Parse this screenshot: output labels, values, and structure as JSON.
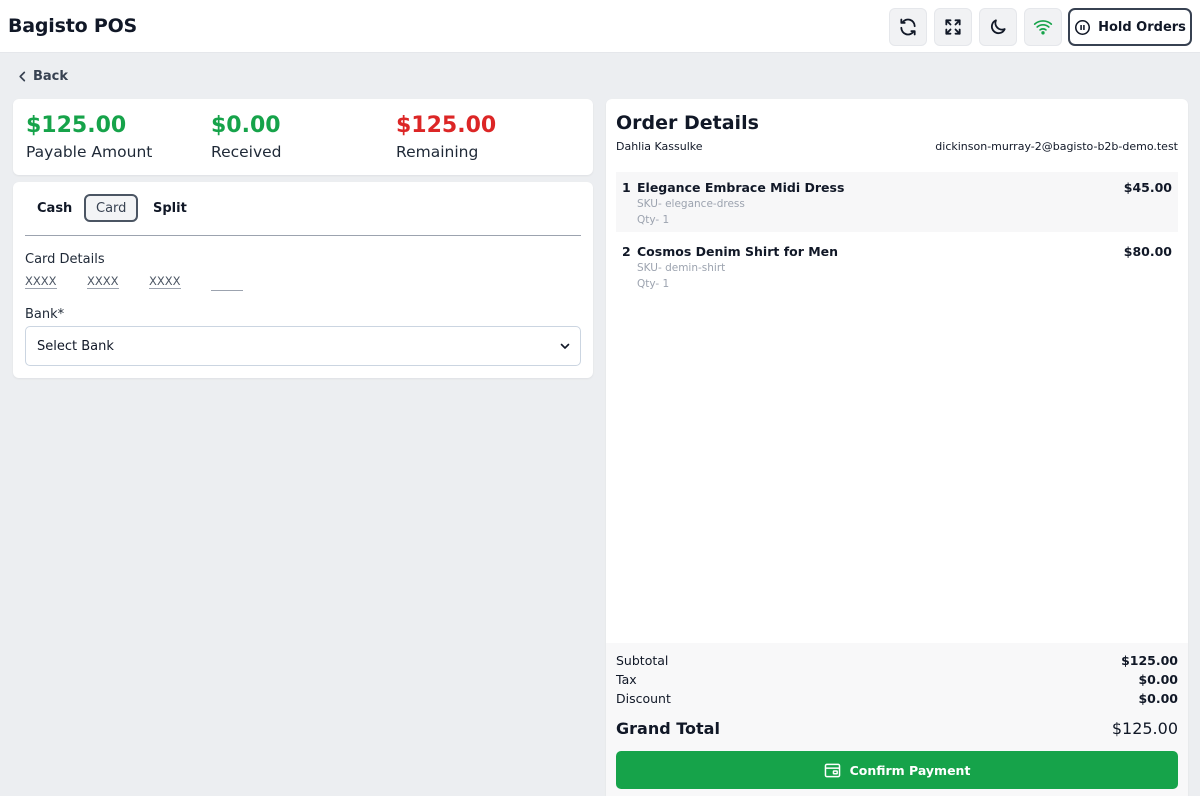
{
  "header": {
    "title": "Bagisto POS",
    "hold_label": "Hold Orders"
  },
  "nav": {
    "back_label": "Back"
  },
  "summary": {
    "payable": {
      "value": "$125.00",
      "label": "Payable Amount"
    },
    "received": {
      "value": "$0.00",
      "label": "Received"
    },
    "remaining": {
      "value": "$125.00",
      "label": "Remaining"
    }
  },
  "payment": {
    "tabs": [
      {
        "label": "Cash",
        "active": false
      },
      {
        "label": "Card",
        "active": true
      },
      {
        "label": "Split",
        "active": false
      }
    ],
    "card_details_label": "Card Details",
    "card_placeholders": [
      "XXXX",
      "XXXX",
      "XXXX",
      ""
    ],
    "bank_label": "Bank*",
    "bank_select_value": "Select Bank"
  },
  "order": {
    "title": "Order Details",
    "customer_name": "Dahlia Kassulke",
    "customer_email": "dickinson-murray-2@bagisto-b2b-demo.test",
    "items": [
      {
        "index": "1",
        "name": "Elegance Embrace Midi Dress",
        "sku": "SKU- elegance-dress",
        "qty": "Qty- 1",
        "price": "$45.00"
      },
      {
        "index": "2",
        "name": "Cosmos Denim Shirt for Men",
        "sku": "SKU- demin-shirt",
        "qty": "Qty- 1",
        "price": "$80.00"
      }
    ],
    "totals": {
      "subtotal": {
        "label": "Subtotal",
        "value": "$125.00"
      },
      "tax": {
        "label": "Tax",
        "value": "$0.00"
      },
      "discount": {
        "label": "Discount",
        "value": "$0.00"
      },
      "grand": {
        "label": "Grand Total",
        "value": "$125.00"
      }
    },
    "confirm_label": "Confirm Payment"
  },
  "colors": {
    "positive": "#16a34a",
    "negative": "#dc2626",
    "accent": "#16a34a"
  },
  "icons": [
    "refresh-icon",
    "fullscreen-icon",
    "moon-icon",
    "wifi-icon",
    "pause-circle-icon",
    "chevron-left-icon",
    "chevron-down-icon",
    "wallet-icon"
  ]
}
